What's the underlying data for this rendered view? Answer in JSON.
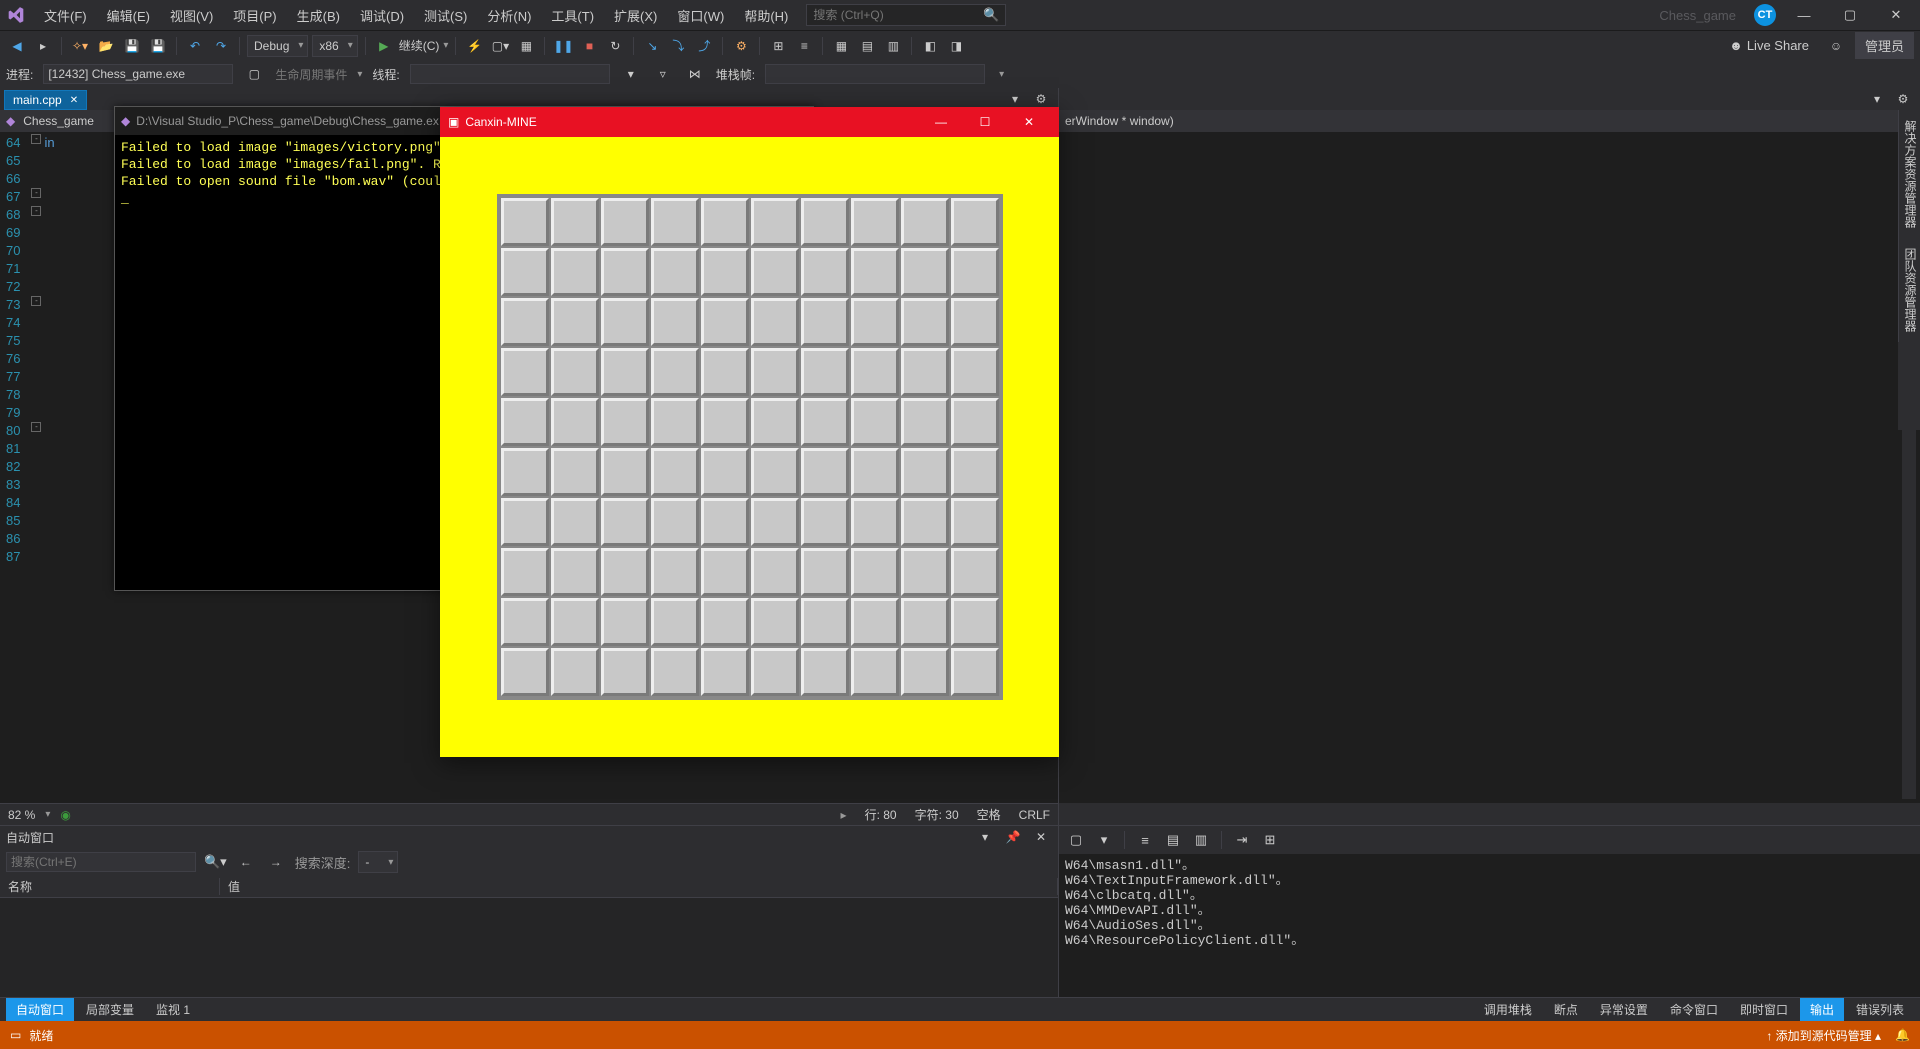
{
  "menu": {
    "items": [
      "文件(F)",
      "编辑(E)",
      "视图(V)",
      "项目(P)",
      "生成(B)",
      "调试(D)",
      "测试(S)",
      "分析(N)",
      "工具(T)",
      "扩展(X)",
      "窗口(W)",
      "帮助(H)"
    ],
    "search_placeholder": "搜索 (Ctrl+Q)",
    "project_label": "Chess_game",
    "avatar": "CT"
  },
  "toolbar": {
    "config": "Debug",
    "platform": "x86",
    "continue_label": "继续(C)",
    "live_share": "Live Share",
    "admin": "管理员"
  },
  "toolbar2": {
    "process_label": "进程:",
    "process_value": "[12432] Chess_game.exe",
    "lifecycle_label": "生命周期事件",
    "thread_label": "线程:",
    "stackframe_label": "堆栈帧:"
  },
  "doc_tab": {
    "name": "main.cpp"
  },
  "context_bar": {
    "scope": "Chess_game"
  },
  "right_context": "erWindow * window)",
  "line_numbers": [
    "64",
    "65",
    "66",
    "67",
    "68",
    "69",
    "70",
    "71",
    "72",
    "73",
    "74",
    "75",
    "76",
    "77",
    "78",
    "79",
    "80",
    "81",
    "82",
    "83",
    "84",
    "85",
    "86",
    "87"
  ],
  "code_prefix": "in",
  "console": {
    "title": "D:\\Visual Studio_P\\Chess_game\\Debug\\Chess_game.ex",
    "lines": [
      "Failed to load image \"images/victory.png\".",
      "Failed to load image \"images/fail.png\". Rea",
      "Failed to open sound file \"bom.wav\" (couldn"
    ]
  },
  "game": {
    "title": "Canxin-MINE",
    "grid_size": 10
  },
  "editor_status": {
    "zoom": "82 %",
    "line": "行: 80",
    "col": "字符: 30",
    "ins": "空格",
    "eol": "CRLF"
  },
  "autos_panel": {
    "title": "自动窗口",
    "search_placeholder": "搜索(Ctrl+E)",
    "depth_label": "搜索深度:",
    "cols": {
      "name": "名称",
      "value": "值"
    }
  },
  "output_lines": [
    "W64\\msasn1.dll\"。",
    "W64\\TextInputFramework.dll\"。",
    "W64\\clbcatq.dll\"。",
    "W64\\MMDevAPI.dll\"。",
    "W64\\AudioSes.dll\"。",
    "W64\\ResourcePolicyClient.dll\"。"
  ],
  "bottom_tabs": {
    "left": [
      "自动窗口",
      "局部变量",
      "监视 1"
    ],
    "right": [
      "调用堆栈",
      "断点",
      "异常设置",
      "命令窗口",
      "即时窗口",
      "输出",
      "错误列表"
    ],
    "active": "输出"
  },
  "right_vtabs": [
    "解决方案资源管理器",
    "团队资源管理器"
  ],
  "statusbar": {
    "ready": "就绪",
    "src_control": "↑ 添加到源代码管理 ▴"
  }
}
